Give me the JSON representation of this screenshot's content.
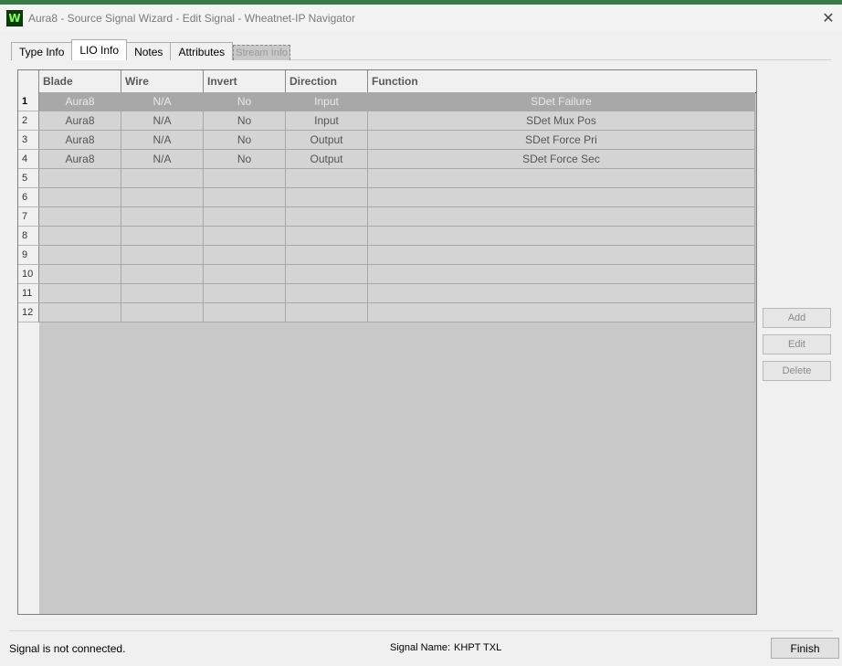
{
  "window": {
    "title": "Aura8 - Source Signal Wizard - Edit Signal - Wheatnet-IP Navigator",
    "close_glyph": "✕",
    "app_icon_letter": "W"
  },
  "tabs": [
    {
      "label": "Type Info"
    },
    {
      "label": "LIO Info"
    },
    {
      "label": "Notes"
    },
    {
      "label": "Attributes"
    },
    {
      "label": "Stream Info"
    }
  ],
  "table": {
    "headers": [
      "Blade",
      "Wire",
      "Invert",
      "Direction",
      "Function"
    ],
    "row_numbers": [
      "1",
      "2",
      "3",
      "4",
      "5",
      "6",
      "7",
      "8",
      "9",
      "10",
      "11",
      "12"
    ],
    "rows": [
      [
        "Aura8",
        "N/A",
        "No",
        "Input",
        "SDet Failure"
      ],
      [
        "Aura8",
        "N/A",
        "No",
        "Input",
        "SDet Mux Pos"
      ],
      [
        "Aura8",
        "N/A",
        "No",
        "Output",
        "SDet Force Pri"
      ],
      [
        "Aura8",
        "N/A",
        "No",
        "Output",
        "SDet Force Sec"
      ],
      [
        "",
        "",
        "",
        "",
        ""
      ],
      [
        "",
        "",
        "",
        "",
        ""
      ],
      [
        "",
        "",
        "",
        "",
        ""
      ],
      [
        "",
        "",
        "",
        "",
        ""
      ],
      [
        "",
        "",
        "",
        "",
        ""
      ],
      [
        "",
        "",
        "",
        "",
        ""
      ],
      [
        "",
        "",
        "",
        "",
        ""
      ],
      [
        "",
        "",
        "",
        "",
        ""
      ]
    ]
  },
  "side_buttons": {
    "add": "Add",
    "edit": "Edit",
    "delete": "Delete"
  },
  "footer": {
    "status": "Signal is not connected.",
    "signal_name_label": "Signal Name:",
    "signal_name_value": "KHPT TXL",
    "finish": "Finish"
  }
}
